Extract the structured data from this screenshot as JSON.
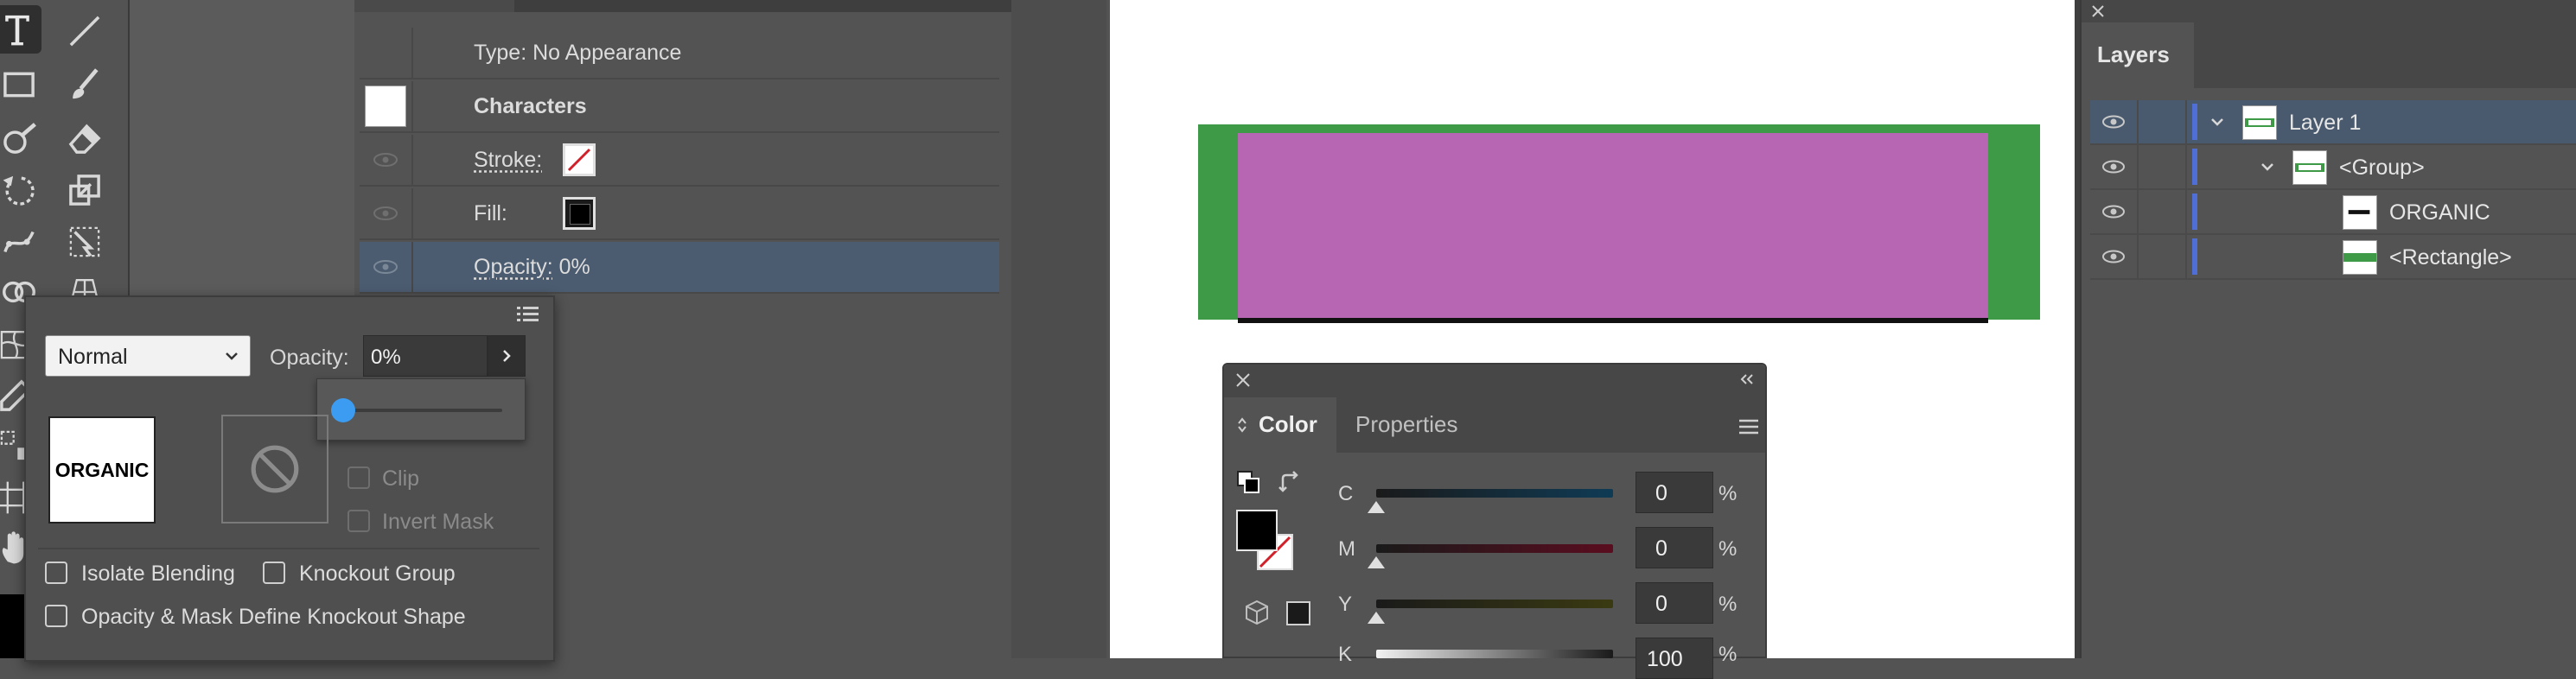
{
  "toolbar": {
    "tools": [
      "type-tool",
      "line-tool",
      "rectangle-tool",
      "paintbrush-tool",
      "shaper-tool",
      "eraser-tool",
      "rotate-tool",
      "scale-tool",
      "puppet-warp-tool",
      "free-transform-tool",
      "mesh-tool",
      "eyedropper-tool",
      "artboard-tool",
      "hand-tool"
    ]
  },
  "appearance": {
    "type_label": "Type: No Appearance",
    "characters_label": "Characters",
    "stroke_label": "Stroke:",
    "fill_label": "Fill:",
    "opacity_label": "Opacity:",
    "opacity_value": "0%"
  },
  "transparency": {
    "blend_mode": "Normal",
    "opacity_label": "Opacity:",
    "opacity_value": "0%",
    "opacity_slider_fraction": 0.0,
    "thumb_text": "ORGANIC",
    "clip_label": "Clip",
    "invert_mask_label": "Invert Mask",
    "isolate_blending_label": "Isolate Blending",
    "knockout_group_label": "Knockout Group",
    "opacity_mask_label": "Opacity & Mask Define Knockout Shape"
  },
  "artboard": {
    "green_color": "#3f9a47",
    "purple_color": "#b766b3"
  },
  "color_panel": {
    "tab_color": "Color",
    "tab_properties": "Properties",
    "channels": [
      {
        "name": "C",
        "value": "0",
        "unit": "%"
      },
      {
        "name": "M",
        "value": "0",
        "unit": "%"
      },
      {
        "name": "Y",
        "value": "0",
        "unit": "%"
      },
      {
        "name": "K",
        "value": "100",
        "unit": "%"
      }
    ]
  },
  "layers": {
    "tab_label": "Layers",
    "rows": [
      {
        "name": "Layer 1"
      },
      {
        "name": "<Group>"
      },
      {
        "name": "ORGANIC"
      },
      {
        "name": "<Rectangle>"
      }
    ]
  }
}
